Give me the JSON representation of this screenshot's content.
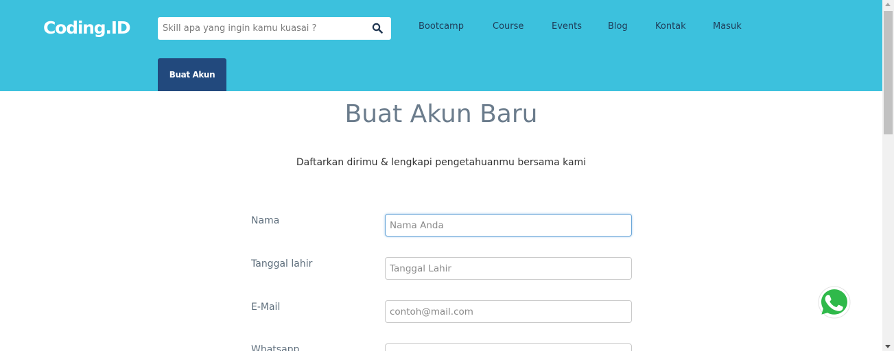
{
  "header": {
    "logo": "Coding.ID",
    "search_placeholder": "Skill apa yang ingin kamu kuasai ?",
    "nav": [
      "Bootcamp",
      "Course",
      "Events",
      "Blog",
      "Kontak",
      "Masuk"
    ],
    "signup_button": "Buat Akun",
    "bg_color": "#3cc1dd",
    "button_color": "#22497d"
  },
  "main": {
    "title": "Buat Akun Baru",
    "subtitle": "Daftarkan dirimu & lengkapi pengetahuanmu bersama kami",
    "fields": [
      {
        "label": "Nama",
        "placeholder": "Nama Anda",
        "value": ""
      },
      {
        "label": "Tanggal lahir",
        "placeholder": "Tanggal Lahir",
        "value": ""
      },
      {
        "label": "E-Mail",
        "placeholder": "contoh@mail.com",
        "value": ""
      },
      {
        "label": "Whatsapp",
        "placeholder": "",
        "value": ""
      }
    ]
  },
  "icons": {
    "search": "search-icon",
    "whatsapp": "whatsapp-icon"
  }
}
